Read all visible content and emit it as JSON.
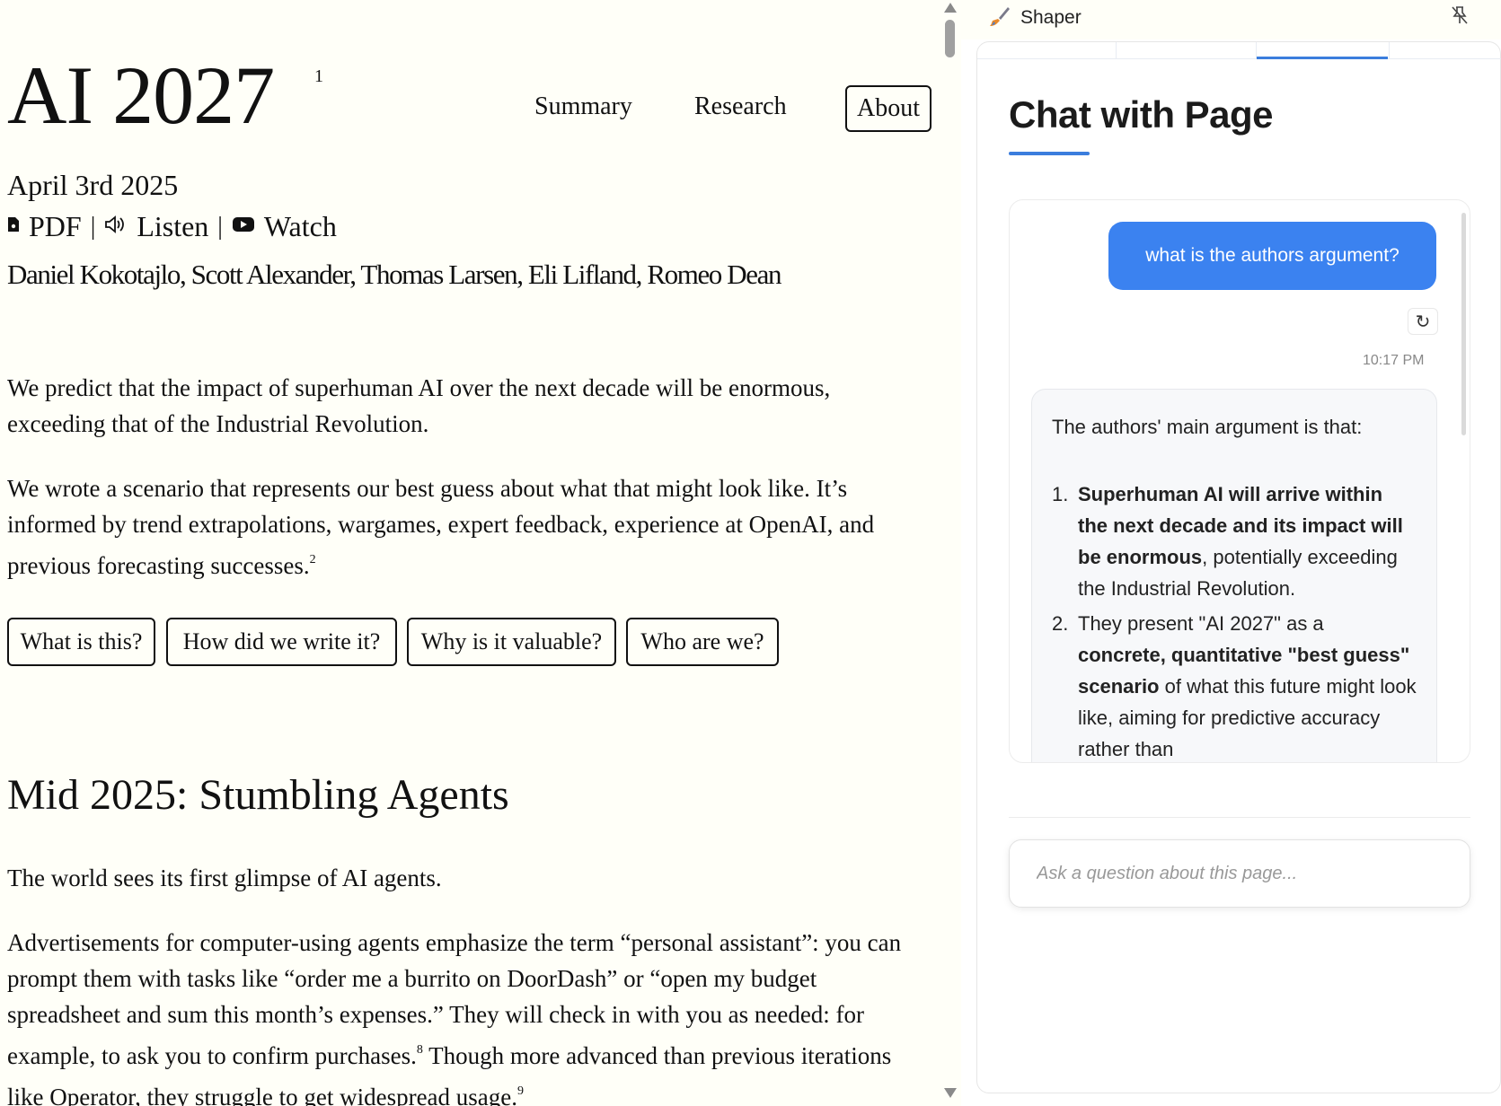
{
  "article": {
    "title": "AI 2027",
    "title_sup": "1",
    "nav": {
      "summary": "Summary",
      "research": "Research",
      "about": "About"
    },
    "date": "April 3rd 2025",
    "links": {
      "pdf": "PDF",
      "listen": "Listen",
      "watch": "Watch",
      "separator": "|"
    },
    "authors": "Daniel Kokotajlo, Scott Alexander, Thomas Larsen, Eli Lifland, Romeo Dean",
    "para1": "We predict that the impact of superhuman AI over the next decade will be enormous, exceeding that of the Industrial Revolution.",
    "para2": "We wrote a scenario that represents our best guess about what that might look like. It’s informed by trend extrapolations, wargames, expert feedback, experience at OpenAI, and previous forecasting successes.",
    "para2_sup": "2",
    "questions": [
      "What is this?",
      "How did we write it?",
      "Why is it valuable?",
      "Who are we?"
    ],
    "section_heading": "Mid 2025: Stumbling Agents",
    "para3": "The world sees its first glimpse of AI agents.",
    "para4_a": "Advertisements for computer-using agents emphasize the term “personal assistant”: you can prompt them with tasks like “order me a burrito on DoorDash” or “open my budget spreadsheet and sum this month’s expenses.” They will check in with you as needed: for example, to ask you to confirm purchases.",
    "para4_sup1": "8",
    "para4_b": " Though more advanced than previous iterations like ",
    "para4_link": "Operator",
    "para4_c": ", they struggle to get widespread usage.",
    "para4_sup2": "9"
  },
  "panel": {
    "app_name": "Shaper",
    "heading": "Chat with Page",
    "accent": "#3b7ddd",
    "user_message": "what is the authors argument?",
    "regenerate_icon": "↻",
    "timestamp": "10:17 PM",
    "ai_intro": "The authors' main argument is that:",
    "ai_item1_num": "1.",
    "ai_item1_bold": "Superhuman AI will arrive within the next decade and its impact will be enormous",
    "ai_item1_rest": ", potentially exceeding the Industrial Revolution.",
    "ai_item2_num": "2.",
    "ai_item2_a": "They present \"AI 2027\" as a ",
    "ai_item2_bold": "concrete, quantitative \"best guess\" scenario",
    "ai_item2_rest": " of what this future might look like, aiming for predictive accuracy rather than",
    "input_placeholder": "Ask a question about this page..."
  }
}
